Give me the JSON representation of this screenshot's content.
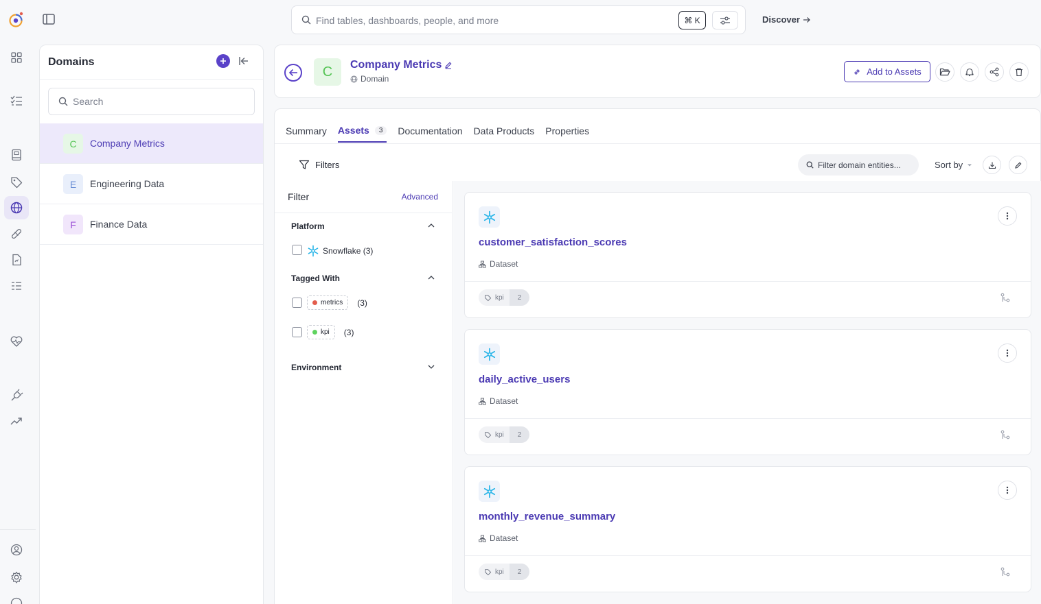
{
  "search": {
    "placeholder": "Find tables, dashboards, people, and more",
    "shortcut": "⌘ K"
  },
  "nav": {
    "discover": "Discover"
  },
  "domains": {
    "title": "Domains",
    "search_placeholder": "Search",
    "items": [
      {
        "letter": "C",
        "label": "Company Metrics",
        "bg": "#e6f7e6",
        "fg": "#55c455"
      },
      {
        "letter": "E",
        "label": "Engineering Data",
        "bg": "#e9effb",
        "fg": "#6b8fd6"
      },
      {
        "letter": "F",
        "label": "Finance Data",
        "bg": "#f1e6fb",
        "fg": "#9b4fd6"
      }
    ]
  },
  "header": {
    "letter": "C",
    "title": "Company Metrics",
    "subtitle": "Domain",
    "add_to_assets": "Add to Assets"
  },
  "tabs": [
    {
      "label": "Summary"
    },
    {
      "label": "Assets",
      "count": "3"
    },
    {
      "label": "Documentation"
    },
    {
      "label": "Data Products"
    },
    {
      "label": "Properties"
    }
  ],
  "toolbar": {
    "filters": "Filters",
    "filter_placeholder": "Filter domain entities...",
    "sort_by": "Sort by"
  },
  "filter_panel": {
    "title": "Filter",
    "advanced": "Advanced",
    "platform": {
      "title": "Platform",
      "option": "Snowflake (3)"
    },
    "tagged_with": {
      "title": "Tagged With",
      "options": [
        {
          "tag": "metrics",
          "count": "(3)",
          "color": "#e35d4d"
        },
        {
          "tag": "kpi",
          "count": "(3)",
          "color": "#5fd35f"
        }
      ]
    },
    "environment": {
      "title": "Environment"
    }
  },
  "assets": [
    {
      "name": "customer_satisfaction_scores",
      "type": "Dataset",
      "tag": "kpi",
      "tag_count": "2"
    },
    {
      "name": "daily_active_users",
      "type": "Dataset",
      "tag": "kpi",
      "tag_count": "2"
    },
    {
      "name": "monthly_revenue_summary",
      "type": "Dataset",
      "tag": "kpi",
      "tag_count": "2"
    }
  ],
  "colors": {
    "accent": "#4b3ab3",
    "brand": "#5a42c9"
  }
}
